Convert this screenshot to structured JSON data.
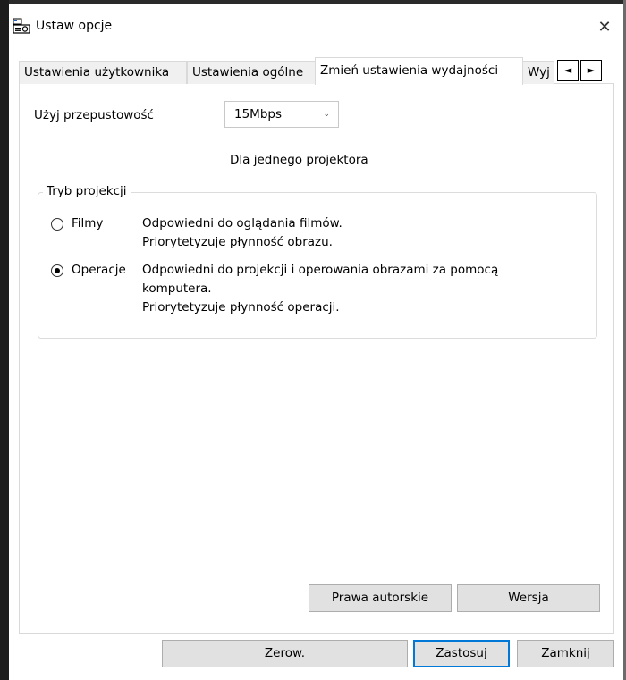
{
  "window": {
    "title": "Ustaw opcje",
    "close_symbol": "✕",
    "icon": "projector-app-icon"
  },
  "tabs": [
    {
      "label": "Ustawienia użytkownika",
      "selected": false
    },
    {
      "label": "Ustawienia ogólne",
      "selected": false
    },
    {
      "label": "Zmień ustawienia wydajności",
      "selected": true
    },
    {
      "label": "Wyj",
      "selected": false
    }
  ],
  "tab_scroll": {
    "left": "◄",
    "right": "►"
  },
  "bandwidth": {
    "label": "Użyj przepustowość",
    "value": "15Mbps",
    "chevron": "⌄",
    "note": "Dla jednego projektora"
  },
  "projection_mode": {
    "group_title": "Tryb projekcji",
    "options": [
      {
        "label": "Filmy",
        "checked": false,
        "description": [
          "Odpowiedni do oglądania filmów.",
          "Priorytetyzuje płynność obrazu."
        ]
      },
      {
        "label": "Operacje",
        "checked": true,
        "description": [
          "Odpowiedni do projekcji i operowania obrazami za pomocą",
          "komputera.",
          "Priorytetyzuje płynność operacji."
        ]
      }
    ]
  },
  "panel_buttons": {
    "copyright": "Prawa autorskie",
    "version": "Wersja"
  },
  "dialog_buttons": {
    "reset": "Zerow.",
    "apply": "Zastosuj",
    "close": "Zamknij"
  }
}
